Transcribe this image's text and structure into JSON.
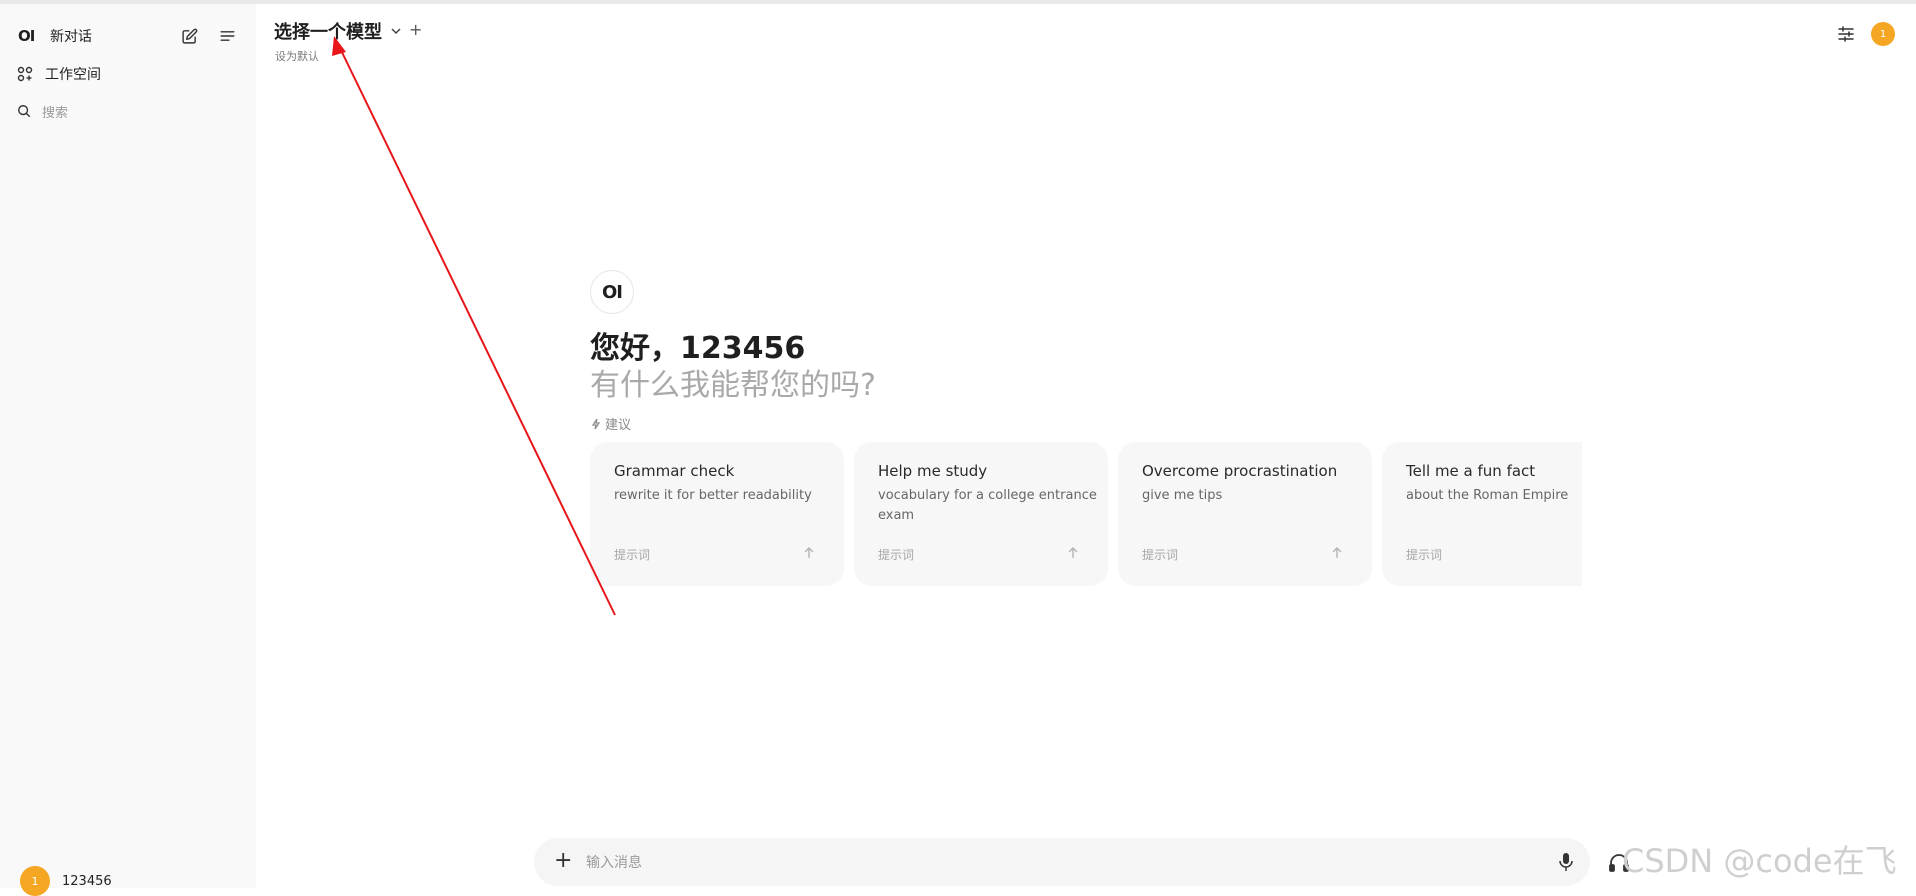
{
  "sidebar": {
    "logo": "OI",
    "new_chat": "新对话",
    "workspace": "工作空间",
    "search_placeholder": "搜索",
    "user": {
      "avatar": "1",
      "name": "123456"
    }
  },
  "header": {
    "model_title": "选择一个模型",
    "set_default": "设为默认",
    "add_symbol": "+",
    "avatar": "1"
  },
  "welcome": {
    "logo": "OI",
    "greeting": "您好，123456",
    "subtitle": "有什么我能帮您的吗?",
    "suggest_label": "建议"
  },
  "suggestions": [
    {
      "title": "Grammar check",
      "subtitle": "rewrite it for better readability",
      "tag": "提示词"
    },
    {
      "title": "Help me study",
      "subtitle": "vocabulary for a college entrance exam",
      "tag": "提示词"
    },
    {
      "title": "Overcome procrastination",
      "subtitle": "give me tips",
      "tag": "提示词"
    },
    {
      "title": "Tell me a fun fact",
      "subtitle": "about the Roman Empire",
      "tag": "提示词"
    }
  ],
  "input": {
    "placeholder": "输入消息",
    "plus": "+"
  },
  "watermark": "CSDN @code在飞",
  "colors": {
    "accent_avatar": "#f5a623",
    "annotation_arrow": "#e8161b",
    "sidebar_bg": "#f9f9f9",
    "card_bg": "#f7f7f7"
  }
}
